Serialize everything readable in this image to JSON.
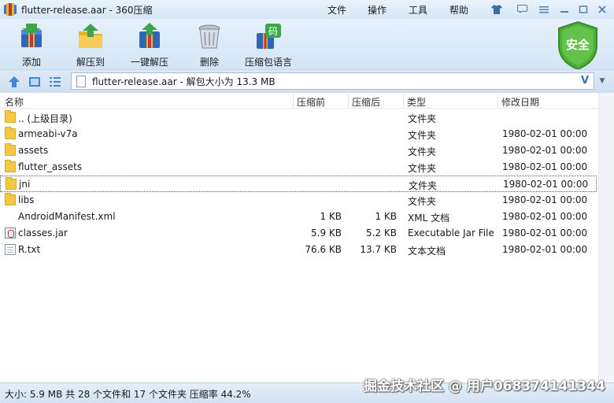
{
  "window": {
    "title": "flutter-release.aar - 360压缩",
    "menu": [
      "文件",
      "操作",
      "工具",
      "帮助"
    ]
  },
  "toolbar": {
    "items": [
      {
        "label": "添加",
        "icon": "add-archive-icon"
      },
      {
        "label": "解压到",
        "icon": "extract-to-icon"
      },
      {
        "label": "一键解压",
        "icon": "one-click-extract-icon"
      },
      {
        "label": "删除",
        "icon": "trash-icon"
      },
      {
        "label": "压缩包语言",
        "icon": "archive-language-icon"
      }
    ],
    "shield_label": "安全",
    "language_icon_char": "码"
  },
  "address": {
    "text": "flutter-release.aar - 解包大小为 13.3 MB",
    "v_glyph": "V",
    "dropdown_glyph": "▼"
  },
  "columns": [
    "名称",
    "压缩前",
    "压缩后",
    "类型",
    "修改日期"
  ],
  "files": [
    {
      "name": ".. (上级目录)",
      "before": "",
      "after": "",
      "type": "文件夹",
      "date": "",
      "icon": "folder"
    },
    {
      "name": "armeabi-v7a",
      "before": "",
      "after": "",
      "type": "文件夹",
      "date": "1980-02-01 00:00",
      "icon": "folder"
    },
    {
      "name": "assets",
      "before": "",
      "after": "",
      "type": "文件夹",
      "date": "1980-02-01 00:00",
      "icon": "folder"
    },
    {
      "name": "flutter_assets",
      "before": "",
      "after": "",
      "type": "文件夹",
      "date": "1980-02-01 00:00",
      "icon": "folder"
    },
    {
      "name": "jni",
      "before": "",
      "after": "",
      "type": "文件夹",
      "date": "1980-02-01 00:00",
      "icon": "folder"
    },
    {
      "name": "libs",
      "before": "",
      "after": "",
      "type": "文件夹",
      "date": "1980-02-01 00:00",
      "icon": "folder"
    },
    {
      "name": "AndroidManifest.xml",
      "before": "1 KB",
      "after": "1 KB",
      "type": "XML 文档",
      "date": "1980-02-01 00:00",
      "icon": "none"
    },
    {
      "name": "classes.jar",
      "before": "5.9 KB",
      "after": "5.2 KB",
      "type": "Executable Jar File",
      "date": "1980-02-01 00:00",
      "icon": "jar"
    },
    {
      "name": "R.txt",
      "before": "76.6 KB",
      "after": "13.7 KB",
      "type": "文本文档",
      "date": "1980-02-01 00:00",
      "icon": "doc"
    }
  ],
  "focused_row": 4,
  "status": {
    "text": "大小: 5.9 MB 共 28 个文件和 17 个文件夹 压缩率 44.2%",
    "watermark": "掘金技术社区 @ 用户068374141344"
  }
}
